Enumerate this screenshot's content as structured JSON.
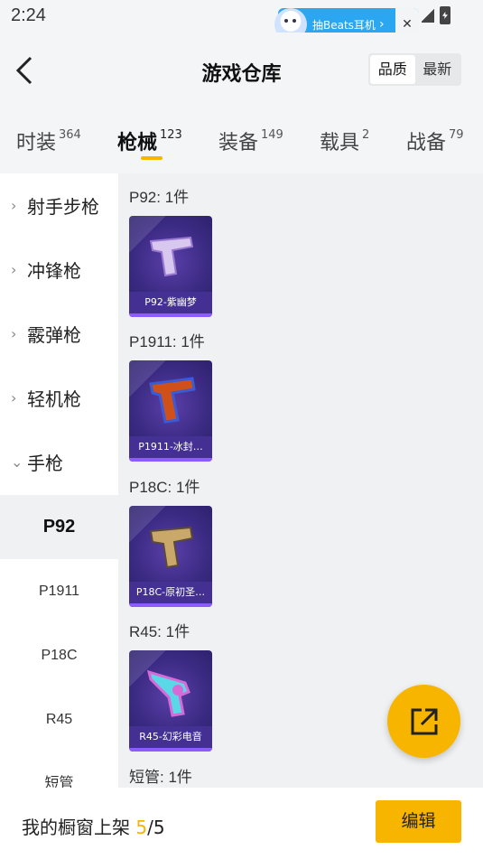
{
  "status_bar": {
    "time": "2:24"
  },
  "ad_banner": {
    "text": "抽Beats耳机",
    "arrow": "›",
    "close": "✕"
  },
  "header": {
    "title": "游戏仓库",
    "sort_options": [
      {
        "label": "品质",
        "active": true
      },
      {
        "label": "最新",
        "active": false
      }
    ]
  },
  "tabs": [
    {
      "label": "时装",
      "count": "364",
      "active": false
    },
    {
      "label": "枪械",
      "count": "123",
      "active": true
    },
    {
      "label": "装备",
      "count": "149",
      "active": false
    },
    {
      "label": "载具",
      "count": "2",
      "active": false
    },
    {
      "label": "战备",
      "count": "79",
      "active": false
    }
  ],
  "sidebar": {
    "categories": [
      {
        "label": "射手步枪",
        "icon": "chevron-right-icon"
      },
      {
        "label": "冲锋枪",
        "icon": "chevron-right-icon"
      },
      {
        "label": "霰弹枪",
        "icon": "chevron-right-icon"
      },
      {
        "label": "轻机枪",
        "icon": "chevron-right-icon"
      },
      {
        "label": "手枪",
        "icon": "chevron-down-icon"
      }
    ],
    "subitems": [
      {
        "label": "P92",
        "active": true
      },
      {
        "label": "P1911",
        "active": false
      },
      {
        "label": "P18C",
        "active": false
      },
      {
        "label": "R45",
        "active": false
      },
      {
        "label": "短管",
        "active": false
      }
    ]
  },
  "groups": [
    {
      "title": "P92: 1件",
      "item": {
        "name": "P92-紫幽梦",
        "colors": [
          "#d8c8f0",
          "#9a7ad0"
        ]
      }
    },
    {
      "title": "P1911: 1件",
      "item": {
        "name": "P1911-冰封…",
        "colors": [
          "#d0501a",
          "#3a5ad8"
        ]
      }
    },
    {
      "title": "P18C: 1件",
      "item": {
        "name": "P18C-原初圣…",
        "colors": [
          "#c9a86a",
          "#5a4a3a"
        ]
      }
    },
    {
      "title": "R45: 1件",
      "item": {
        "name": "R45-幻彩电音",
        "colors": [
          "#5ad8e8",
          "#d86ad8"
        ]
      }
    },
    {
      "title": "短管: 1件"
    }
  ],
  "bottom_bar": {
    "label": "我的橱窗上架",
    "current": "5",
    "separator": "/",
    "total": "5",
    "edit_label": "编辑"
  },
  "colors": {
    "accent": "#f7b500",
    "card_bg": "#3a2a82",
    "ad_blue": "#2aa7f0"
  }
}
